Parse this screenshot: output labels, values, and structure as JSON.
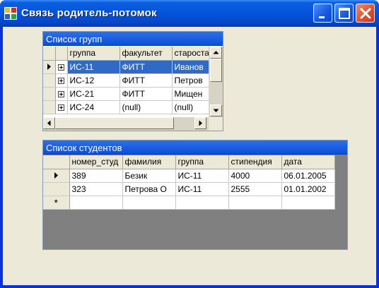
{
  "window": {
    "title": "Связь родитель-потомок",
    "colors": {
      "titlebar": "#0553dc",
      "client": "#ece9d8",
      "selection": "#316ac5",
      "grid_bg": "#808080"
    }
  },
  "groups_grid": {
    "caption": "Список групп",
    "columns": [
      "группа",
      "факультет",
      "староста"
    ],
    "rows": [
      [
        "ИС-11",
        "ФИТТ",
        "Иванов"
      ],
      [
        "ИС-12",
        "ФИТТ",
        "Петров"
      ],
      [
        "ИС-21",
        "ФИТТ",
        "Мищен"
      ],
      [
        "ИС-24",
        "(null)",
        "(null)"
      ]
    ]
  },
  "students_grid": {
    "caption": "Список студентов",
    "columns": [
      "номер_студ",
      "фамилия",
      "группа",
      "стипендия",
      "дата"
    ],
    "rows": [
      [
        "389",
        "Безик",
        "ИС-11",
        "4000",
        "06.01.2005"
      ],
      [
        "323",
        "Петрова О",
        "ИС-11",
        "2555",
        "01.01.2002"
      ]
    ],
    "new_row_marker": "*"
  }
}
